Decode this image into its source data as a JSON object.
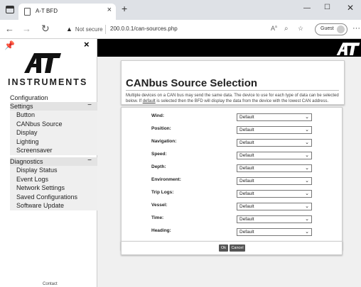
{
  "browser": {
    "tab_title": "A-T BFD",
    "tab_close": "×",
    "new_tab": "+",
    "security_label": "Not secure",
    "url": "200.0.0.1/can-sources.php",
    "guest_label": "Guest"
  },
  "sidebar": {
    "brand": "INSTRUMENTS",
    "configuration": "Configuration",
    "settings": {
      "label": "Settings",
      "items": [
        "Button",
        "CANbus Source",
        "Display",
        "Lighting",
        "Screensaver"
      ]
    },
    "diagnostics": {
      "label": "Diagnostics",
      "items": [
        "Display Status",
        "Event Logs",
        "Network Settings",
        "Saved Configurations",
        "Software Update"
      ]
    },
    "contact": "Contact"
  },
  "content": {
    "title": "CANbus Source Selection",
    "desc_pre": "Multiple devices on a CAN bus may send the same data. The device to use for each type of data can be selected below. If ",
    "desc_link": "default",
    "desc_post": " is selected then the BFD will display the data from the device with the lowest CAN address.",
    "rows": [
      {
        "label": "Wind:",
        "value": "Default"
      },
      {
        "label": "Position:",
        "value": "Default"
      },
      {
        "label": "Navigation:",
        "value": "Default"
      },
      {
        "label": "Speed:",
        "value": "Default"
      },
      {
        "label": "Depth:",
        "value": "Default"
      },
      {
        "label": "Environment:",
        "value": "Default"
      },
      {
        "label": "Trip Logs:",
        "value": "Default"
      },
      {
        "label": "Vessel:",
        "value": "Default"
      },
      {
        "label": "Time:",
        "value": "Default"
      },
      {
        "label": "Heading:",
        "value": "Default"
      }
    ],
    "ok_label": "Ok",
    "cancel_label": "Cancel"
  }
}
